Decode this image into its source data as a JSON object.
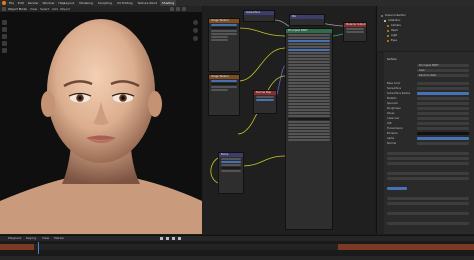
{
  "menu": [
    "File",
    "Edit",
    "Render",
    "Window",
    "Help"
  ],
  "workspace_tabs": [
    "Layout",
    "Modeling",
    "Sculpting",
    "UV Editing",
    "Texture Paint",
    "Shading"
  ],
  "viewport": {
    "mode_label": "Object Mode",
    "view_label": "View",
    "select_label": "Select",
    "add_label": "Add",
    "object_label": "Object"
  },
  "node_editor": {
    "nodes": [
      {
        "title": "Image Texture"
      },
      {
        "title": "Image Texture"
      },
      {
        "title": "Normal Map"
      },
      {
        "title": "Principled BSDF"
      },
      {
        "title": "Material Output"
      },
      {
        "title": "Subsurface"
      },
      {
        "title": "Mix"
      },
      {
        "title": "Bump"
      }
    ]
  },
  "outliner": {
    "items": [
      "Scene Collection",
      "Collection",
      "Camera",
      "Head",
      "Light",
      "Eyes"
    ]
  },
  "properties": {
    "section": "Surface",
    "fields": [
      "Principled BSDF",
      "GGX",
      "Random Walk",
      "Base Color",
      "Subsurface",
      "Subsurface Radius",
      "Metallic",
      "Specular",
      "Roughness",
      "Sheen",
      "Clearcoat",
      "IOR",
      "Transmission",
      "Emission",
      "Alpha",
      "Normal"
    ]
  },
  "timeline": {
    "labels": [
      "Playback",
      "Keying",
      "View",
      "Marker"
    ]
  },
  "colors": {
    "accent": "#4772b3",
    "brand": "#e87d0d",
    "keyframe": "#7a3a23"
  }
}
